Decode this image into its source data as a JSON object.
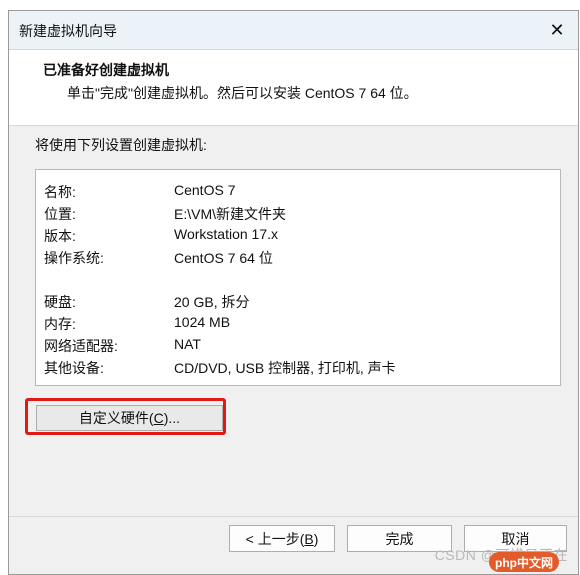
{
  "window": {
    "title": "新建虚拟机向导",
    "close_glyph": "✕"
  },
  "header": {
    "title": "已准备好创建虚拟机",
    "subtitle": "单击\"完成\"创建虚拟机。然后可以安装 CentOS 7 64 位。"
  },
  "section_label": "将使用下列设置创建虚拟机:",
  "summary": {
    "rows": [
      {
        "key": "名称:",
        "value": "CentOS 7"
      },
      {
        "key": "位置:",
        "value": "E:\\VM\\新建文件夹"
      },
      {
        "key": "版本:",
        "value": "Workstation 17.x"
      },
      {
        "key": "操作系统:",
        "value": "CentOS 7 64 位"
      },
      {
        "key": "硬盘:",
        "value": "20 GB, 拆分"
      },
      {
        "key": "内存:",
        "value": "1024 MB"
      },
      {
        "key": "网络适配器:",
        "value": "NAT"
      },
      {
        "key": "其他设备:",
        "value": "CD/DVD, USB 控制器, 打印机, 声卡"
      }
    ]
  },
  "buttons": {
    "customize_prefix": "自定义硬件(",
    "customize_key": "C",
    "customize_suffix": ")...",
    "back_prefix": "< 上一步(",
    "back_key": "B",
    "back_suffix": ")",
    "finish": "完成",
    "cancel": "取消"
  },
  "watermark": "CSDN @可惜只不在",
  "php_badge": "php中文网"
}
